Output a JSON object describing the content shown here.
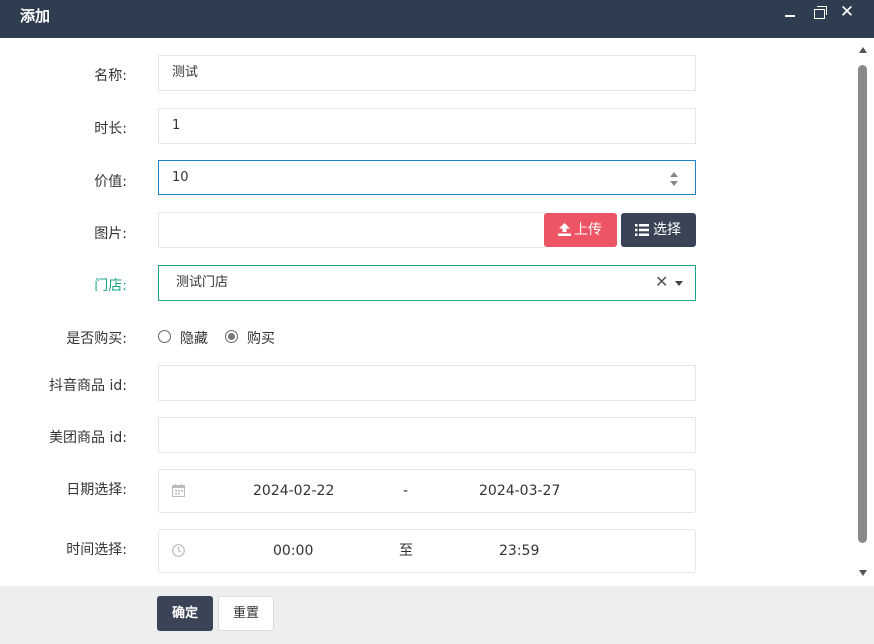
{
  "window": {
    "title": "添加",
    "min": "minimize",
    "max": "maximize",
    "close": "✕"
  },
  "form": {
    "name": {
      "label": "名称:",
      "value": "测试"
    },
    "duration": {
      "label": "时长:",
      "value": "1"
    },
    "price": {
      "label": "价值:",
      "value": "10"
    },
    "image": {
      "label": "图片:",
      "value": "",
      "upload_label": "上传",
      "choose_label": "选择"
    },
    "store": {
      "label": "门店:",
      "value": "测试门店"
    },
    "purchasable": {
      "label": "是否购买:",
      "options": [
        "隐藏",
        "购买"
      ],
      "selected": "购买"
    },
    "douyin_id": {
      "label": "抖音商品 id:",
      "value": ""
    },
    "meituan_id": {
      "label": "美团商品 id:",
      "value": ""
    },
    "date_range": {
      "label": "日期选择:",
      "start": "2024-02-22",
      "separator": "-",
      "end": "2024-03-27"
    },
    "time_range": {
      "label": "时间选择:",
      "start": "00:00",
      "separator": "至",
      "end": "23:59"
    }
  },
  "footer": {
    "confirm_label": "确定",
    "reset_label": "重置"
  },
  "colors": {
    "titlebar": "#2e3d4f",
    "upload": "#ed5565",
    "primary": "#3b4357",
    "teal": "#18a689",
    "focus": "#1c84c6"
  }
}
